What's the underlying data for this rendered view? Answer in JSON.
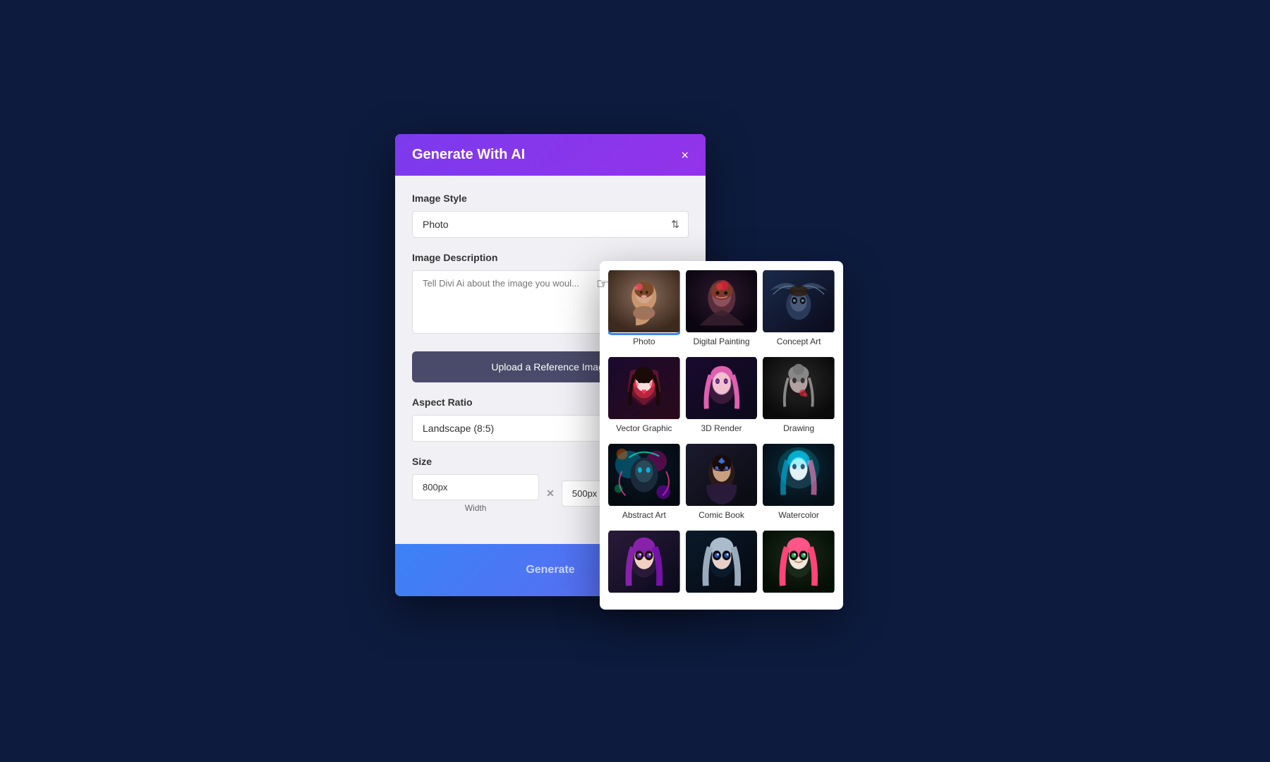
{
  "dialog": {
    "title": "Generate With AI",
    "close_label": "×",
    "image_style_label": "Image Style",
    "image_style_value": "Photo",
    "image_description_label": "Image Description",
    "image_description_placeholder": "Tell Divi Ai about the image you woul...",
    "upload_button_label": "Upload a Reference Image",
    "aspect_ratio_label": "Aspect Ratio",
    "aspect_ratio_value": "Landscape (8:5)",
    "size_label": "Size",
    "width_value": "800px",
    "height_value": "500px",
    "width_label": "Width",
    "generate_button_label": "Generate"
  },
  "style_picker": {
    "styles": [
      {
        "id": "photo",
        "label": "Photo",
        "selected": true
      },
      {
        "id": "digital-painting",
        "label": "Digital Painting",
        "selected": false
      },
      {
        "id": "concept-art",
        "label": "Concept Art",
        "selected": false
      },
      {
        "id": "vector-graphic",
        "label": "Vector Graphic",
        "selected": false
      },
      {
        "id": "3d-render",
        "label": "3D Render",
        "selected": false
      },
      {
        "id": "drawing",
        "label": "Drawing",
        "selected": false
      },
      {
        "id": "abstract-art",
        "label": "Abstract Art",
        "selected": false
      },
      {
        "id": "comic-book",
        "label": "Comic Book",
        "selected": false
      },
      {
        "id": "watercolor",
        "label": "Watercolor",
        "selected": false
      },
      {
        "id": "anime1",
        "label": "",
        "selected": false
      },
      {
        "id": "anime2",
        "label": "",
        "selected": false
      },
      {
        "id": "anime3",
        "label": "",
        "selected": false
      }
    ]
  },
  "colors": {
    "bg": "#0d1b3e",
    "header_gradient_start": "#7c3aed",
    "header_gradient_end": "#9333ea",
    "footer_gradient_start": "#3b82f6",
    "selected_border": "#3b82f6"
  }
}
